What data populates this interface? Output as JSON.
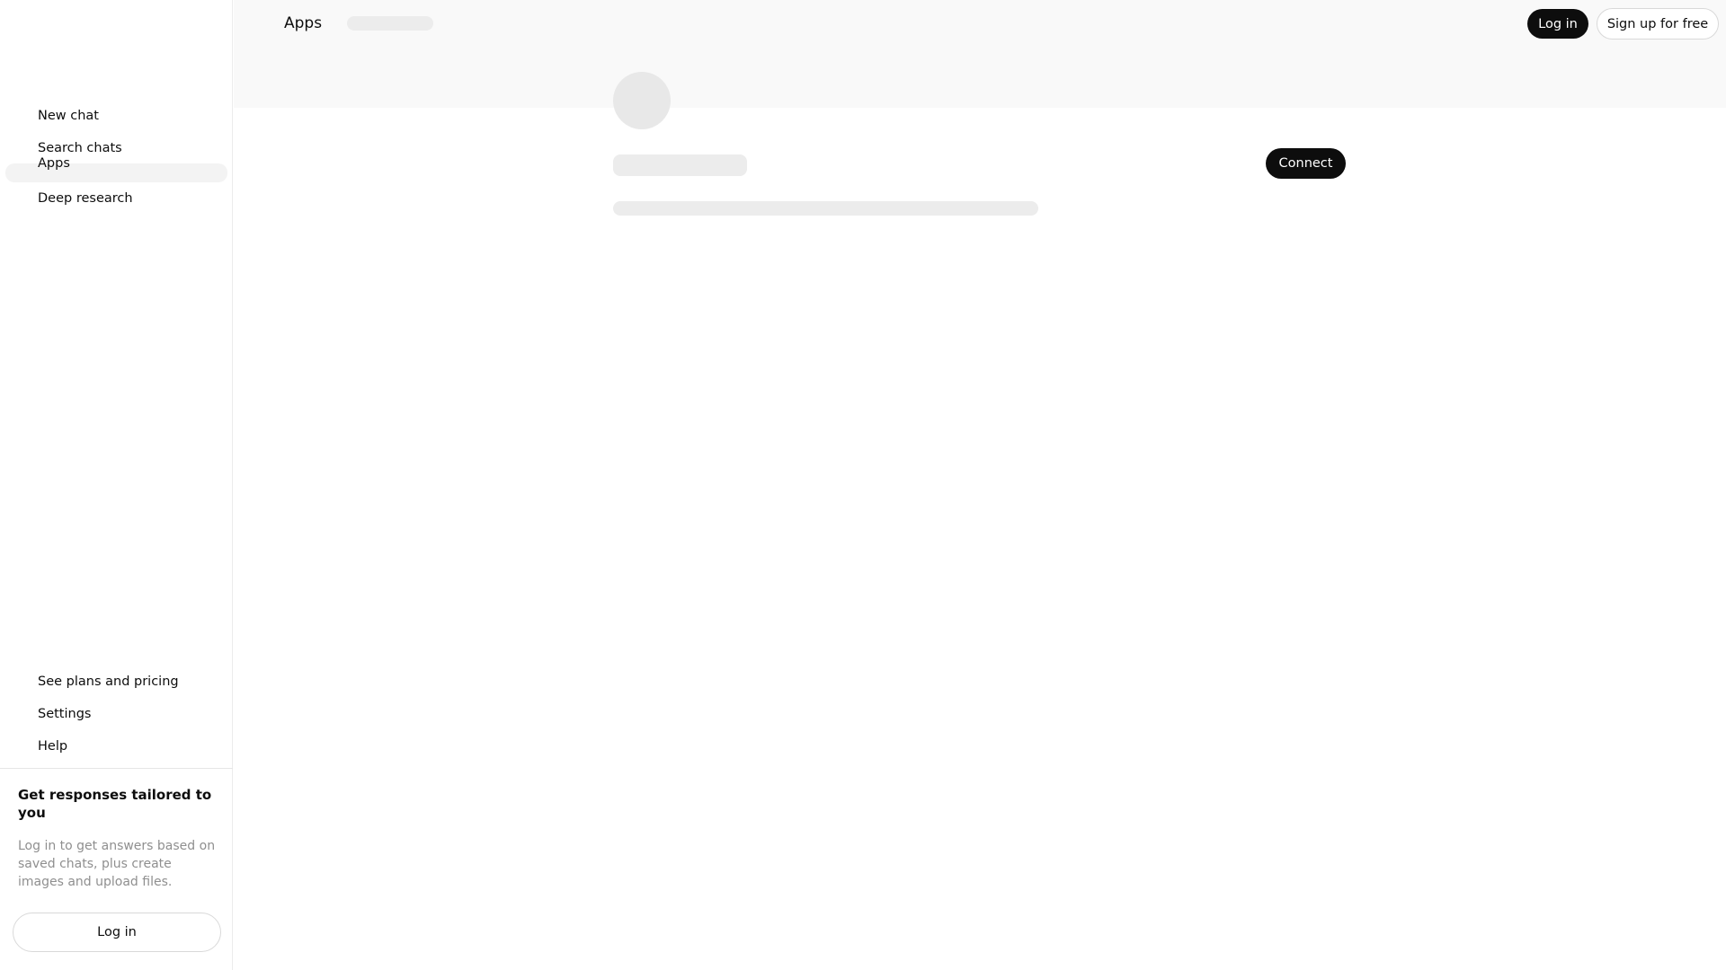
{
  "sidebar": {
    "nav_items": [
      {
        "label": "New chat"
      },
      {
        "label": "Search chats"
      },
      {
        "label": "Apps"
      },
      {
        "label": "Deep research"
      }
    ],
    "footer_items": [
      {
        "label": "See plans and pricing"
      },
      {
        "label": "Settings"
      },
      {
        "label": "Help"
      }
    ],
    "promo": {
      "title": "Get responses tailored to you",
      "text": "Log in to get answers based on saved chats, plus create images and upload files.",
      "login_label": "Log in"
    }
  },
  "header": {
    "title": "Apps",
    "login_label": "Log in",
    "signup_label": "Sign up for free"
  },
  "main": {
    "connect_label": "Connect"
  },
  "colors": {
    "primary_button": "#0d0d0d",
    "skeleton": "#ececec",
    "banner": "#f9f9f9"
  }
}
